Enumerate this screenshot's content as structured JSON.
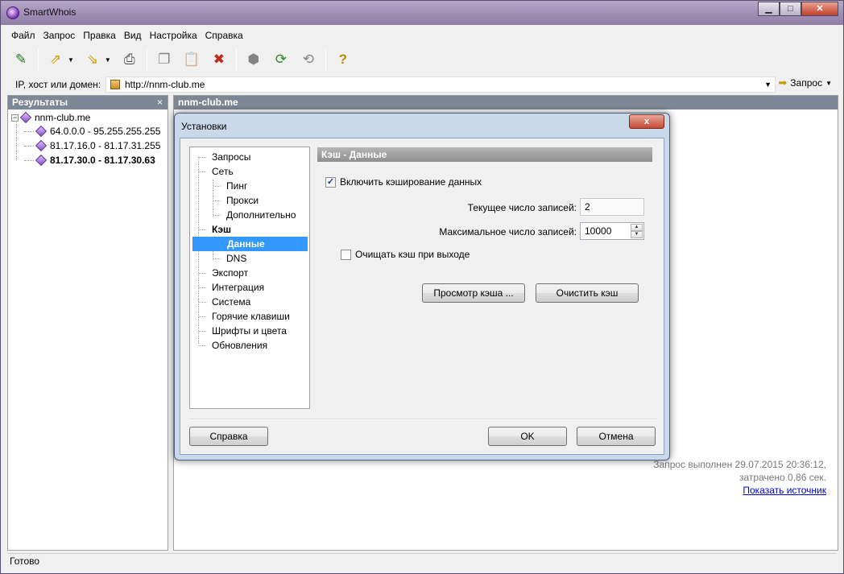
{
  "window": {
    "title": "SmartWhois",
    "min": "0",
    "max": "1",
    "close": "r"
  },
  "menu": [
    "Файл",
    "Запрос",
    "Правка",
    "Вид",
    "Настройка",
    "Справка"
  ],
  "addressbar": {
    "label": "IP, хост или домен:",
    "value": "http://nnm-club.me",
    "go_label": "Запрос"
  },
  "results": {
    "header": "Результаты",
    "close": "×",
    "root": "nnm-club.me",
    "items": [
      "64.0.0.0 - 95.255.255.255",
      "81.17.16.0 - 81.17.31.255",
      "81.17.30.0 - 81.17.30.63"
    ]
  },
  "detail": {
    "header": "nnm-club.me",
    "footer_line1": "Запрос выполнен 29.07.2015 20:36:12,",
    "footer_line2": "затрачено 0,86 сек.",
    "show_source": "Показать источник"
  },
  "statusbar": {
    "text": "Готово"
  },
  "dialog": {
    "title": "Установки",
    "close": "x",
    "nav": {
      "requests": "Запросы",
      "network": "Сеть",
      "ping": "Пинг",
      "proxy": "Прокси",
      "advanced": "Дополнительно",
      "cache": "Кэш",
      "data": "Данные",
      "dns": "DNS",
      "export": "Экспорт",
      "integration": "Интеграция",
      "system": "Система",
      "hotkeys": "Горячие клавиши",
      "fonts": "Шрифты и цвета",
      "updates": "Обновления"
    },
    "section_title": "Кэш - Данные",
    "enable_cache": {
      "label": "Включить кэширование данных",
      "checked": true,
      "mark": "✓"
    },
    "current_count_label": "Текущее число записей:",
    "current_count": "2",
    "max_count_label": "Максимальное число записей:",
    "max_count": "10000",
    "clear_on_exit": {
      "label": "Очищать кэш при выходе",
      "checked": false
    },
    "view_cache_button": "Просмотр кэша ...",
    "clear_cache_button": "Очистить кэш",
    "help_button": "Справка",
    "ok_button": "OK",
    "cancel_button": "Отмена"
  }
}
